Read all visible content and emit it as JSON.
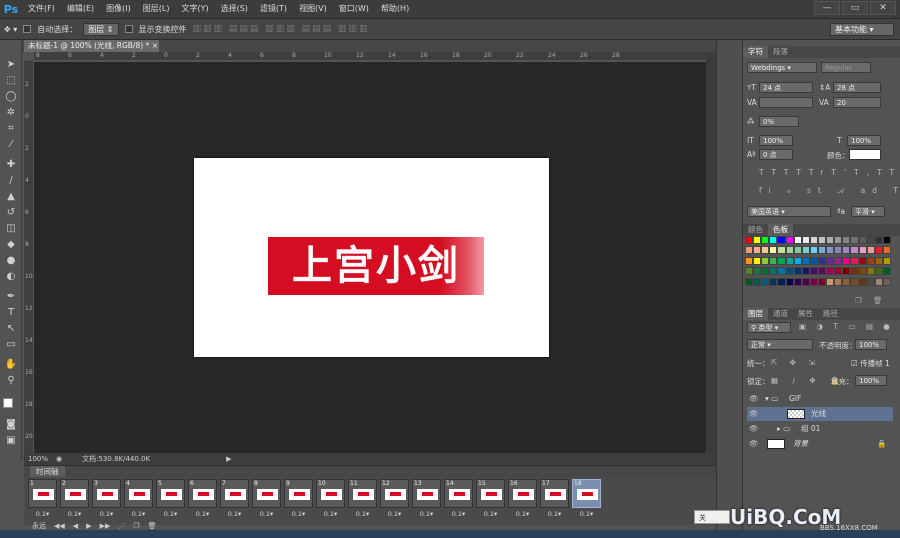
{
  "app": {
    "logo": "Ps"
  },
  "menu": [
    "文件(F)",
    "编辑(E)",
    "图像(I)",
    "图层(L)",
    "文字(Y)",
    "选择(S)",
    "滤镜(T)",
    "视图(V)",
    "窗口(W)",
    "帮助(H)"
  ],
  "window_controls": {
    "minimize": "—",
    "restore": "▭",
    "close": "✕"
  },
  "options": {
    "auto_select_label": "自动选择：",
    "auto_select_value": "图层",
    "show_transform_label": "显示变换控件",
    "workspace": "基本功能"
  },
  "document": {
    "tab_title": "未标题-1 @ 100% (光线, RGB/8) *",
    "banner_text": "上宫小剑",
    "ruler_ticks": [
      "8",
      "6",
      "4",
      "2",
      "0",
      "2",
      "4",
      "6",
      "8",
      "10",
      "12",
      "14",
      "16",
      "18",
      "20",
      "22",
      "24",
      "26",
      "28"
    ],
    "ruler_left_ticks": [
      "2",
      "0",
      "2",
      "4",
      "6",
      "8",
      "10",
      "12",
      "14",
      "16",
      "18",
      "20"
    ]
  },
  "status": {
    "zoom": "100%",
    "doc_size": "文档:530.8K/440.0K"
  },
  "timeline": {
    "tab": "时间轴",
    "frames": [
      "1",
      "2",
      "3",
      "4",
      "5",
      "6",
      "7",
      "8",
      "9",
      "10",
      "11",
      "12",
      "13",
      "14",
      "15",
      "16",
      "17",
      "18"
    ],
    "delay": "0.1▾",
    "selected_index": 17,
    "loop": "永远"
  },
  "character_panel": {
    "tabs": [
      "字符",
      "段落"
    ],
    "font_family": "Webdings",
    "font_style": "Regular",
    "font_size": "24 点",
    "leading": "28 点",
    "tracking": "20",
    "scale_label": "0%",
    "v_scale": "100%",
    "h_scale": "100%",
    "baseline": "0 点",
    "color_label": "颜色：",
    "styles": [
      "T",
      "T",
      "TT",
      "Tr",
      "T'",
      "T,",
      "T",
      "T"
    ],
    "language": "美国英语",
    "aa": "平滑"
  },
  "swatches_panel": {
    "tabs": [
      "颜色",
      "色板"
    ],
    "colors": [
      "#ff0000",
      "#ffff00",
      "#00ff00",
      "#00ffff",
      "#0000ff",
      "#ff00ff",
      "#ffffff",
      "#ebebeb",
      "#d6d6d6",
      "#c2c2c2",
      "#adadad",
      "#999999",
      "#858585",
      "#707070",
      "#5c5c5c",
      "#474747",
      "#333333",
      "#000000",
      "#f7977a",
      "#f9ad81",
      "#fdc68a",
      "#fff79a",
      "#c4df9b",
      "#a2d39c",
      "#82ca9d",
      "#7bcdc8",
      "#6ecff6",
      "#7ea7d8",
      "#8493ca",
      "#8882be",
      "#a187be",
      "#bc8dbf",
      "#f49ac2",
      "#f6989d",
      "#ed1c24",
      "#f26522",
      "#f7941d",
      "#fff200",
      "#8dc63f",
      "#39b54a",
      "#00a651",
      "#00a99d",
      "#00aeef",
      "#0072bc",
      "#0054a6",
      "#2e3192",
      "#662d91",
      "#92278f",
      "#ec008c",
      "#ed145b",
      "#9e0b0f",
      "#a0410d",
      "#a36209",
      "#aba000",
      "#598527",
      "#1a7b30",
      "#007236",
      "#00746b",
      "#0076a3",
      "#004b80",
      "#003471",
      "#1b1464",
      "#440e62",
      "#630460",
      "#9e005d",
      "#9e0039",
      "#790000",
      "#7b2e00",
      "#7d4900",
      "#827b00",
      "#406618",
      "#005e20",
      "#005826",
      "#005952",
      "#005b7f",
      "#003663",
      "#002157",
      "#0d004c",
      "#32004b",
      "#4b0049",
      "#7b0046",
      "#7a0026",
      "#c69c6d",
      "#a67c52",
      "#8c6239",
      "#754c24",
      "#603913",
      "#534741",
      "#998675",
      "#736357"
    ]
  },
  "layers_panel": {
    "tabs": [
      "图层",
      "通道",
      "属性",
      "路径"
    ],
    "filter_kind": "类型",
    "blend_mode": "正常",
    "opacity_label": "不透明度：",
    "opacity": "100%",
    "unify_label": "统一：",
    "propagate_label": "传播帧 1",
    "lock_label": "锁定：",
    "fill_label": "填充：",
    "fill": "100%",
    "layers": [
      {
        "name": "GIF",
        "type": "group"
      },
      {
        "name": "光线",
        "type": "layer"
      },
      {
        "name": "组 01",
        "type": "group"
      },
      {
        "name": "背景",
        "type": "background"
      }
    ]
  },
  "watermark": {
    "text": "UiBQ.CoM",
    "sub": "BBS.16XX8.COM",
    "tip": "关"
  }
}
